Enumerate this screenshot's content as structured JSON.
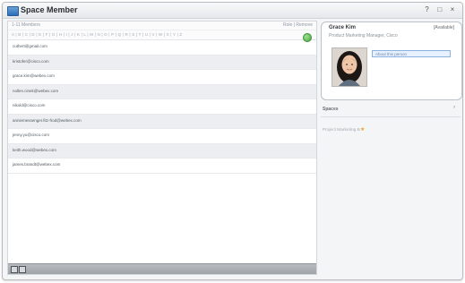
{
  "window": {
    "title": "Space Member",
    "buttons": [
      "?",
      "□",
      "×"
    ]
  },
  "toolbar": {
    "left": "1-11 Members",
    "right": "Role | Remove"
  },
  "alphabet": "A | B | C | D | E | F | G | H | I | J | K | L | M | N | O | P | Q | R | S | T | U | V | W | X | Y | Z",
  "members": [
    "cuthert@gmail.com",
    "kristofer@cisco.com",
    "grace.kim@webex.com",
    "nollen.cinek@webex.com",
    "nikold@cisco.com",
    "anniemessenger.fitz-frod@webex.com",
    "jenny.yu@cisco.com",
    "keith.wood@webex.com",
    "james.brandt@webex.com"
  ],
  "profile": {
    "name": "Grace Kim",
    "status": "[Available]",
    "role": "Product Marketing Manager, Cisco",
    "about_label": "About this person"
  },
  "side": {
    "spaces_label": "Spaces",
    "project_label": "Project Marketing B"
  }
}
